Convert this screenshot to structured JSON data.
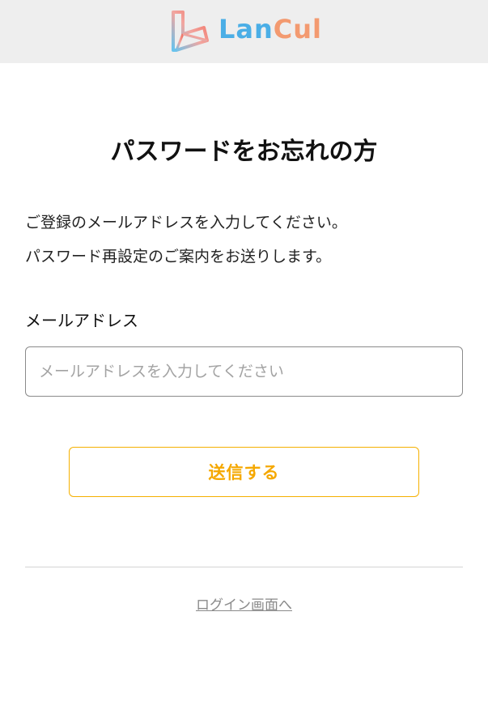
{
  "header": {
    "logo_text_part1": "Lan",
    "logo_text_part2": "Cul",
    "logo_colors": {
      "blue": "#4aaee6",
      "coral": "#f39a70"
    }
  },
  "main": {
    "title": "パスワードをお忘れの方",
    "description_line1": "ご登録のメールアドレスを入力してください。",
    "description_line2": "パスワード再設定のご案内をお送りします。",
    "email_label": "メールアドレス",
    "email_placeholder": "メールアドレスを入力してください",
    "email_value": "",
    "submit_label": "送信する",
    "login_link": "ログイン画面へ"
  },
  "colors": {
    "accent": "#f5a800",
    "header_bg": "#eeeeee",
    "link": "#8a8a8a"
  }
}
